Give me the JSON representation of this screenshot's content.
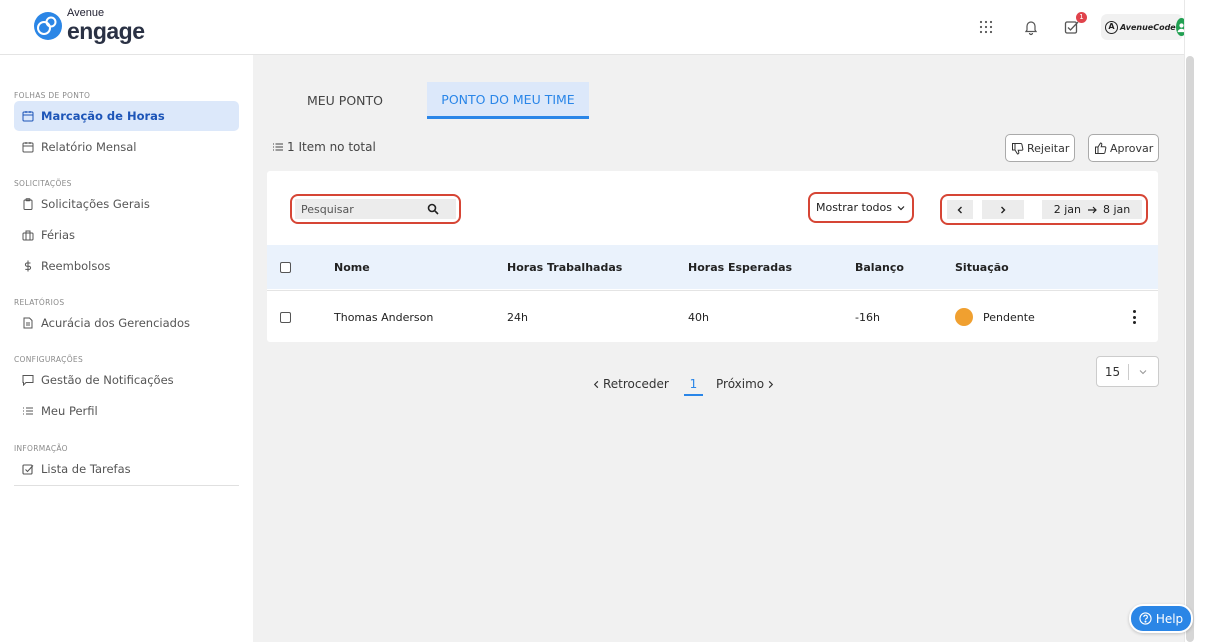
{
  "brand": {
    "sub": "Avenue",
    "main": "engage",
    "color": "#2b86e6"
  },
  "header": {
    "apps_icon": "grid-icon",
    "notifications_icon": "bell-icon",
    "tasks_icon": "checkbox-icon",
    "tasks_badge": "1",
    "account_company": "AvenueCode",
    "account_logo_letter": "A"
  },
  "sidebar": {
    "sections": [
      {
        "title": "FOLHAS DE PONTO",
        "items": [
          {
            "label": "Marcação de Horas",
            "icon": "calendar-icon",
            "active": true
          },
          {
            "label": "Relatório Mensal",
            "icon": "calendar-icon",
            "active": false
          }
        ]
      },
      {
        "title": "SOLICITAÇÕES",
        "items": [
          {
            "label": "Solicitações Gerais",
            "icon": "clipboard-icon"
          },
          {
            "label": "Férias",
            "icon": "beach-icon"
          },
          {
            "label": "Reembolsos",
            "icon": "dollar-icon"
          }
        ]
      },
      {
        "title": "RELATÓRIOS",
        "items": [
          {
            "label": "Acurácia dos Gerenciados",
            "icon": "document-icon"
          }
        ]
      },
      {
        "title": "CONFIGURAÇÕES",
        "items": [
          {
            "label": "Gestão de Notificações",
            "icon": "message-icon"
          },
          {
            "label": "Meu Perfil",
            "icon": "list-icon"
          }
        ]
      },
      {
        "title": "INFORMAÇÃO",
        "items": [
          {
            "label": "Lista de Tarefas",
            "icon": "checkbox-icon"
          }
        ]
      }
    ]
  },
  "tabs": [
    {
      "label": "MEU PONTO",
      "active": false
    },
    {
      "label": "PONTO DO MEU TIME",
      "active": true
    }
  ],
  "summary": {
    "count_text": "1 Item no total"
  },
  "actions": {
    "reject_label": "Rejeitar",
    "approve_label": "Aprovar"
  },
  "toolbar": {
    "search_placeholder": "Pesquisar",
    "filter_label": "Mostrar todos",
    "date_start": "2 jan",
    "date_end": "8 jan"
  },
  "table": {
    "columns": [
      "Nome",
      "Horas Trabalhadas",
      "Horas Esperadas",
      "Balanço",
      "Situação"
    ],
    "rows": [
      {
        "name": "Thomas Anderson",
        "worked": "24h",
        "expected": "40h",
        "balance": "-16h",
        "status": "Pendente",
        "status_color": "#f0a030"
      }
    ]
  },
  "pagination": {
    "prev_label": "Retroceder",
    "current_page": "1",
    "next_label": "Próximo",
    "page_size": "15"
  },
  "help": {
    "label": "Help"
  },
  "colors": {
    "accent": "#2a86e8",
    "active_bg": "#dce8fa",
    "highlight_outline": "#d64535"
  }
}
